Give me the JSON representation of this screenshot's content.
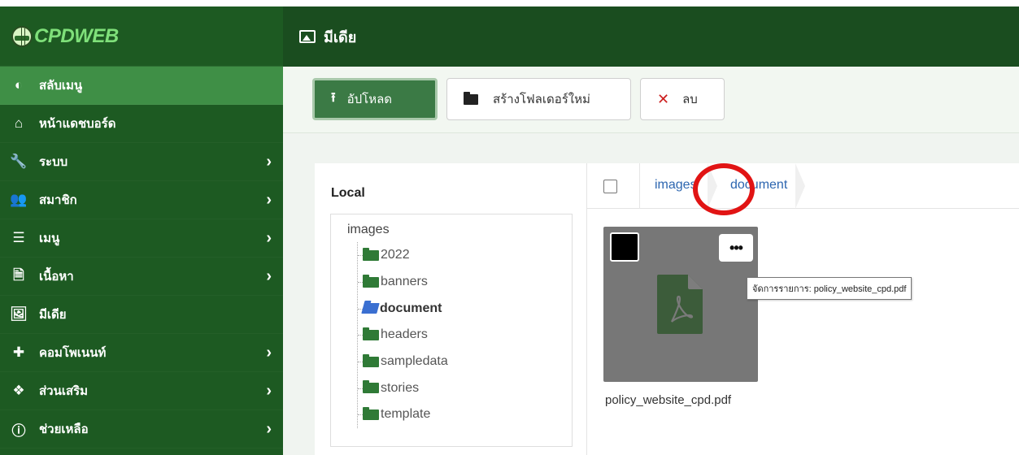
{
  "brand": {
    "name": "CPDWEB"
  },
  "header": {
    "title": "มีเดีย",
    "icon": "image-icon"
  },
  "sidebar": {
    "items": [
      {
        "label": "สลับเมนู",
        "icon": "toggle-icon",
        "glyph": "◐",
        "has_submenu": false,
        "active": true
      },
      {
        "label": "หน้าแดชบอร์ด",
        "icon": "home-icon",
        "glyph": "⌂",
        "has_submenu": false,
        "active": false
      },
      {
        "label": "ระบบ",
        "icon": "wrench-icon",
        "glyph": "🔧",
        "has_submenu": true,
        "active": false
      },
      {
        "label": "สมาชิก",
        "icon": "users-icon",
        "glyph": "👥",
        "has_submenu": true,
        "active": false
      },
      {
        "label": "เมนู",
        "icon": "list-icon",
        "glyph": "☰",
        "has_submenu": true,
        "active": false
      },
      {
        "label": "เนื้อหา",
        "icon": "file-icon",
        "glyph": "🗎",
        "has_submenu": true,
        "active": false
      },
      {
        "label": "มีเดีย",
        "icon": "image-icon",
        "glyph": "🖼",
        "has_submenu": false,
        "active": false
      },
      {
        "label": "คอมโพเนนท์",
        "icon": "puzzle-icon",
        "glyph": "✚",
        "has_submenu": true,
        "active": false
      },
      {
        "label": "ส่วนเสริม",
        "icon": "cubes-icon",
        "glyph": "❖",
        "has_submenu": true,
        "active": false
      },
      {
        "label": "ช่วยเหลือ",
        "icon": "info-icon",
        "glyph": "ⓘ",
        "has_submenu": true,
        "active": false
      }
    ]
  },
  "toolbar": {
    "upload_label": "อัปโหลด",
    "new_folder_label": "สร้างโฟลเดอร์ใหม่",
    "delete_label": "ลบ"
  },
  "tree": {
    "title": "Local",
    "root": "images",
    "folders": [
      "2022",
      "banners",
      "document",
      "headers",
      "sampledata",
      "stories",
      "template"
    ],
    "current": "document"
  },
  "breadcrumb": [
    "images",
    "document"
  ],
  "files": [
    {
      "name": "policy_website_cpd.pdf",
      "type": "pdf",
      "tooltip": "จัดการรายการ: policy_website_cpd.pdf",
      "more_glyph": "•••"
    }
  ],
  "colors": {
    "sidebar": "#1d5a22",
    "topbar": "#1a4d1f",
    "accent": "#3b7a45",
    "highlight_ring": "#e11414"
  }
}
